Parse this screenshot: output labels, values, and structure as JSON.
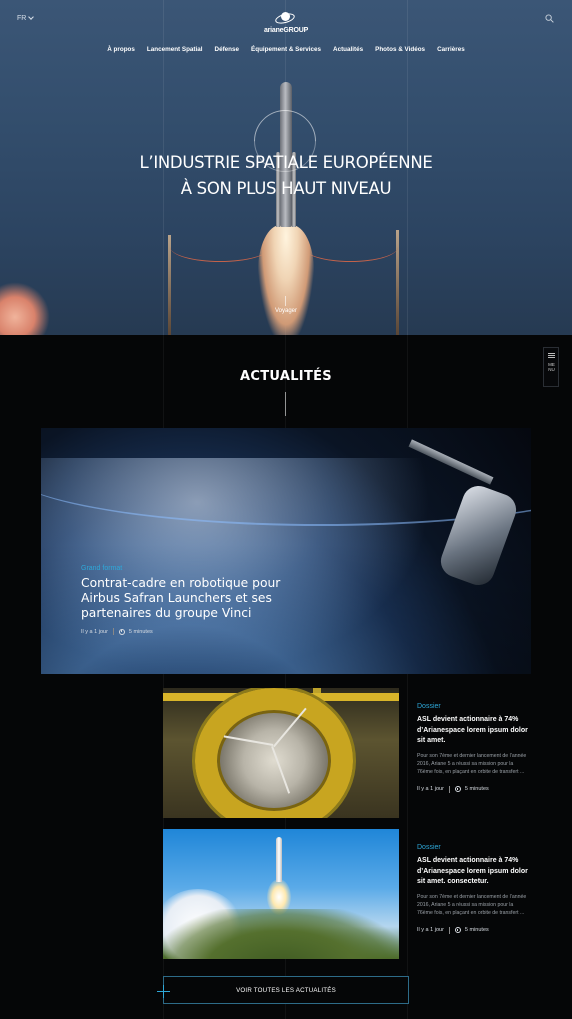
{
  "header": {
    "language": "FR",
    "logo_text": "arianeGROUP",
    "nav": [
      "À propos",
      "Lancement Spatial",
      "Défense",
      "Équipement & Services",
      "Actualités",
      "Photos & Vidéos",
      "Carrières"
    ]
  },
  "hero": {
    "headline_line1": "L’INDUSTRIE SPATIALE EUROPÉENNE",
    "headline_line2": "À SON PLUS HAUT NIVEAU",
    "voyager": "Voyager"
  },
  "menu_tab": "MENU",
  "news": {
    "title": "ACTUALITÉS",
    "featured": {
      "category": "Grand format",
      "title": "Contrat-cadre en robotique pour Airbus Safran Launchers et ses partenaires du groupe Vinci",
      "age": "Il y a 1 jour",
      "read_time": "5 minutes"
    },
    "cards": [
      {
        "category": "Dossier",
        "title": "ASL devient actionnaire à 74% d’Arianespace lorem ipsum dolor sit amet.",
        "excerpt": "Pour son 7ème et dernier lancement de l’année 2016, Ariane 5 a réussi sa mission pour la 76ème fois, en plaçant en orbite de transfert ...",
        "age": "Il y a 1 jour",
        "read_time": "5 minutes"
      },
      {
        "category": "Dossier",
        "title": "ASL devient actionnaire à 74% d’Arianespace lorem ipsum dolor sit amet. consectetur.",
        "excerpt": "Pour son 7ème et dernier lancement de l’année 2016, Ariane 5 a réussi sa mission pour la 76ème fois, en plaçant en orbite de transfert ...",
        "age": "Il y a 1 jour",
        "read_time": "5 minutes"
      }
    ],
    "all_button": "VOIR TOUTES LES ACTUALITÉS"
  },
  "colors": {
    "accent": "#2ea8d9",
    "background": "#050607"
  }
}
